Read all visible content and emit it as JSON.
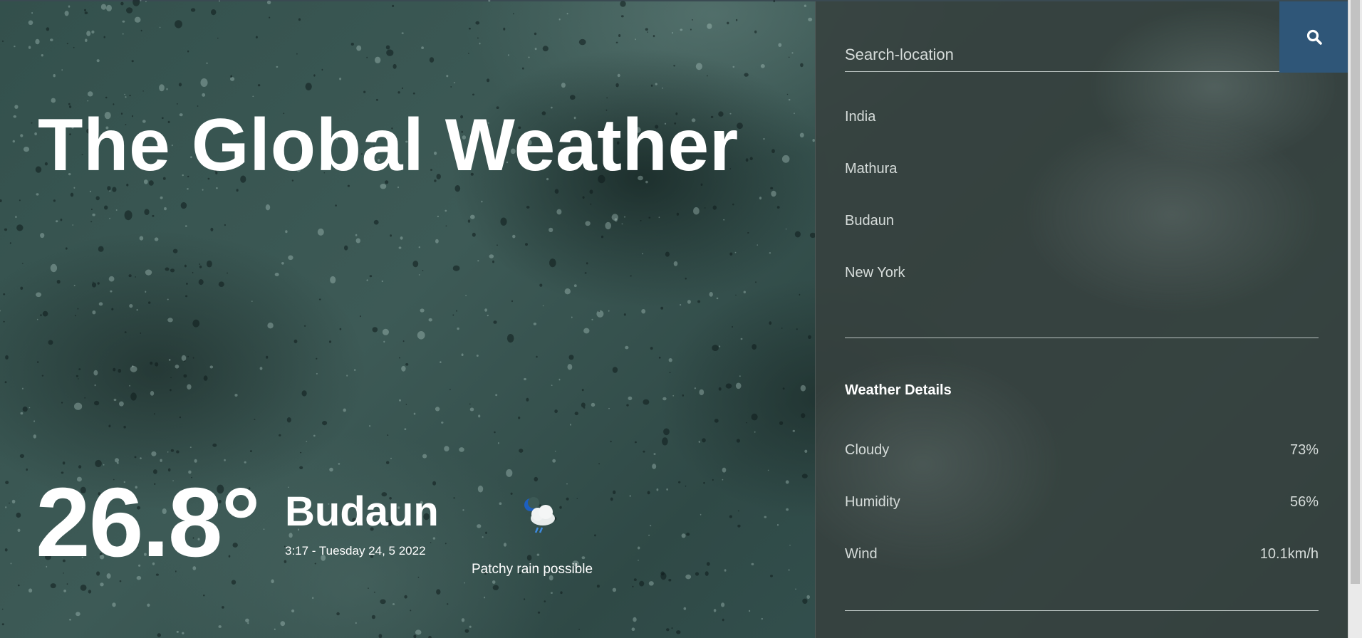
{
  "brand": {
    "title": "The Global Weather"
  },
  "current": {
    "temperature": "26.8°",
    "city": "Budaun",
    "datetime": "3:17 - Tuesday 24, 5 2022",
    "condition": "Patchy rain possible",
    "condition_icon": "moon-cloud-rain-icon"
  },
  "search": {
    "placeholder": "Search-location",
    "button_icon": "search-icon"
  },
  "locations": [
    "India",
    "Mathura",
    "Budaun",
    "New York"
  ],
  "details": {
    "title": "Weather Details",
    "items": [
      {
        "label": "Cloudy",
        "value": "73%"
      },
      {
        "label": "Humidity",
        "value": "56%"
      },
      {
        "label": "Wind",
        "value": "10.1km/h"
      }
    ]
  },
  "colors": {
    "search_button": "#2f5678",
    "panel": "#374140",
    "text": "#ffffff"
  }
}
